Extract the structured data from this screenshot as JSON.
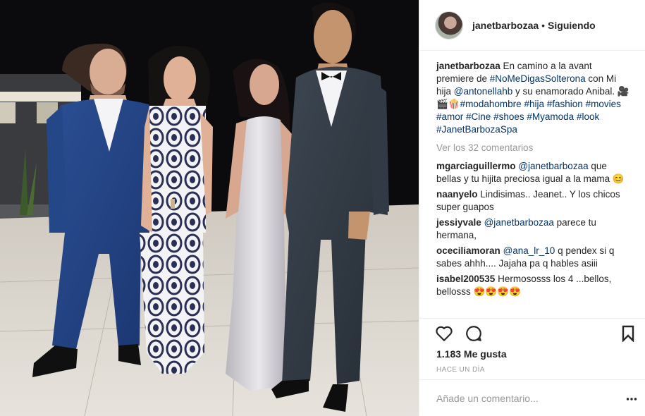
{
  "header": {
    "username": "janetbarbozaa",
    "separator": "•",
    "follow_state": "Siguiendo"
  },
  "caption": {
    "author": "janetbarbozaa",
    "text_1": " En camino a la avant premiere de ",
    "tag_1": "#NoMeDigasSolterona",
    "text_2": " con Mi hija ",
    "mention_1": "@antonellahb",
    "text_3": " y su enamorado Anibal. 🎥🎬🍿",
    "tags": [
      "#modahombre",
      "#hija",
      "#fashion",
      "#movies",
      "#amor",
      "#Cine",
      "#shoes",
      "#Myamoda",
      "#look",
      "#JanetBarbozaSpa"
    ]
  },
  "view_comments": "Ver los 32 comentarios",
  "comments": [
    {
      "author": "mgarciaguillermo",
      "mention": "@janetbarbozaa",
      "text": " que bellas y tu hijita preciosa igual a la mama 😊"
    },
    {
      "author": "naanyelo",
      "mention": "",
      "text": " Lindisimas.. Jeanet.. Y los chicos super guapos"
    },
    {
      "author": "jessiyvale",
      "mention": "@janetbarbozaa",
      "text": " parece tu hermana,"
    },
    {
      "author": "oceciliamoran",
      "mention": "@ana_lr_10",
      "text": " q pendex si q sabes ahhh.... Jajaha pa q hables asiii"
    },
    {
      "author": "isabel200535",
      "mention": "",
      "text": " Hermososss los 4 ...bellos, bellosss 😍😍😍😍"
    }
  ],
  "actions": {
    "like_icon": "heart-icon",
    "comment_icon": "speech-bubble-icon",
    "save_icon": "bookmark-icon"
  },
  "likes_text": "1.183 Me gusta",
  "timestamp": "HACE UN DÍA",
  "comment_input": {
    "placeholder": "Añade un comentario...",
    "value": ""
  },
  "more_icon": "more-options-icon",
  "colors": {
    "link": "#003569",
    "muted": "#999999",
    "text": "#262626",
    "border": "#efefef"
  }
}
